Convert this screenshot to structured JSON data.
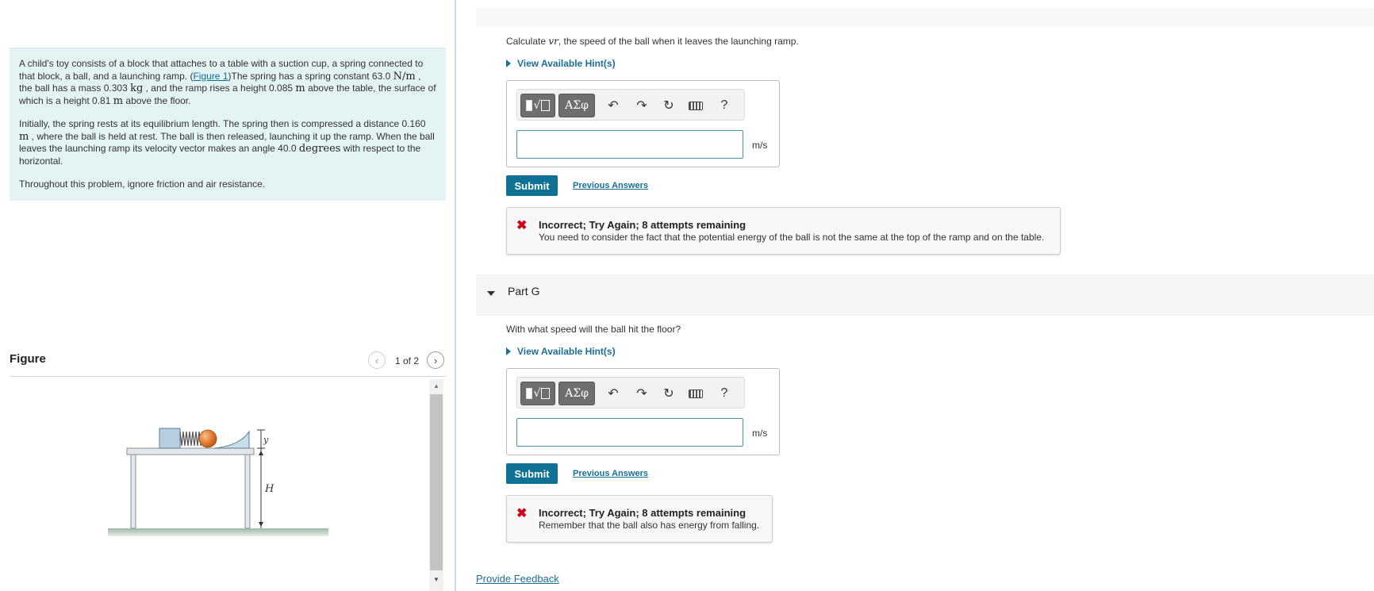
{
  "problem": {
    "p1_a": "A child's toy consists of a block that attaches to a table with a suction cup, a spring connected to that block, a ball, and a launching ramp. (",
    "figure_link": "Figure 1",
    "p1_b": ")The spring has a spring constant 63.0 ",
    "unit_spring": "N/m",
    "p1_c": " , the ball has a mass 0.303 ",
    "unit_mass": "kg",
    "p1_d": " , and the ramp rises a height 0.085 ",
    "unit_m1": "m",
    "p1_e": " above the table, the surface of which is a height 0.81 ",
    "unit_m2": "m",
    "p1_f": " above the floor.",
    "p2_a": "Initially, the spring rests at its equilibrium length. The spring then is compressed a distance 0.160 ",
    "unit_m3": "m",
    "p2_b": " , where the ball is held at rest. The ball is then released, launching it up the ramp. When the ball leaves the launching ramp its velocity vector makes an angle 40.0 ",
    "unit_deg": "degrees",
    "p2_c": " with respect to the horizontal.",
    "p3": "Throughout this problem, ignore friction and air resistance."
  },
  "figure": {
    "title": "Figure",
    "counter": "1 of 2",
    "prev_icon": "chevron-left-icon",
    "next_icon": "chevron-right-icon",
    "label_y": "y",
    "label_H": "H"
  },
  "part_f": {
    "question_a": "Calculate ",
    "question_var": "vr",
    "question_b": ", the speed of the ball when it leaves the launching ramp.",
    "hint": "View Available Hint(s)",
    "input_value": "",
    "unit": "m/s",
    "submit": "Submit",
    "previous_answers": "Previous Answers",
    "feedback_title": "Incorrect; Try Again; 8 attempts remaining",
    "feedback_msg": "You need to consider the fact that the potential energy of the ball is not the same at the top of the ramp and on the table."
  },
  "part_g": {
    "label": "Part G",
    "question": "With what speed will the ball hit the floor?",
    "hint": "View Available Hint(s)",
    "input_value": "",
    "unit": "m/s",
    "submit": "Submit",
    "previous_answers": "Previous Answers",
    "feedback_title": "Incorrect; Try Again; 8 attempts remaining",
    "feedback_msg": "Remember that the ball also has energy from falling."
  },
  "toolbar": {
    "greek_label": "ΑΣφ",
    "help_label": "?",
    "icons": [
      "templates-icon",
      "greek-symbols-icon",
      "undo-icon",
      "redo-icon",
      "reset-icon",
      "keyboard-icon",
      "help-icon"
    ]
  },
  "footer": {
    "provide_feedback": "Provide Feedback"
  },
  "colors": {
    "problem_bg": "#e4f3f4",
    "accent": "#0f7294",
    "link": "#1a6e98",
    "error": "#d0021b"
  }
}
